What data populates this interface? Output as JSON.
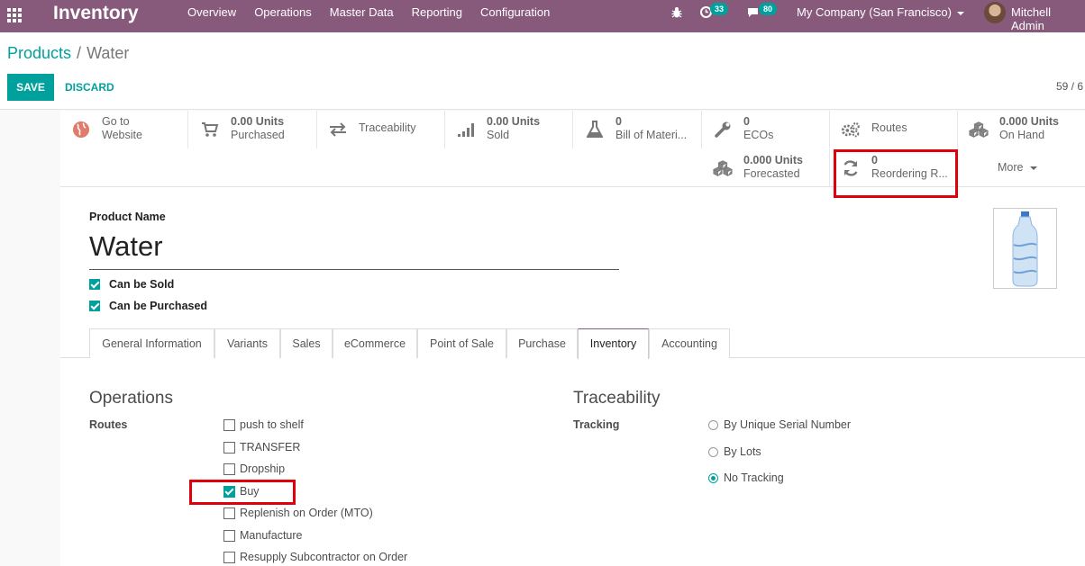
{
  "navbar": {
    "app_title": "Inventory",
    "menu": [
      "Overview",
      "Operations",
      "Master Data",
      "Reporting",
      "Configuration"
    ],
    "activity_count": "33",
    "messages_count": "80",
    "company": "My Company (San Francisco)",
    "user": "Mitchell Admin",
    "icons": [
      "apps-grid-icon",
      "bug-icon",
      "activity-clock-icon",
      "chat-icon"
    ]
  },
  "breadcrumb": {
    "parent": "Products",
    "separator": "/",
    "current": "Water"
  },
  "actions": {
    "save": "SAVE",
    "discard": "DISCARD"
  },
  "pager": {
    "text": "59 / 6"
  },
  "smart_buttons": [
    {
      "id": "website",
      "value": "Go to",
      "label": "Website",
      "icon": "globe-icon"
    },
    {
      "id": "purchased",
      "value": "0.00 Units",
      "label": "Purchased",
      "icon": "cart-icon"
    },
    {
      "id": "traceability",
      "value": "",
      "label": "Traceability",
      "icon": "arrows-exchange-icon"
    },
    {
      "id": "sold",
      "value": "0.00 Units",
      "label": "Sold",
      "icon": "signal-bars-icon"
    },
    {
      "id": "bom",
      "value": "0",
      "label": "Bill of Materi...",
      "icon": "flask-icon"
    },
    {
      "id": "ecos",
      "value": "0",
      "label": "ECOs",
      "icon": "wrench-icon"
    },
    {
      "id": "routes",
      "value": "",
      "label": "Routes",
      "icon": "gears-icon"
    },
    {
      "id": "onhand",
      "value": "0.000 Units",
      "label": "On Hand",
      "icon": "cubes-icon"
    },
    {
      "id": "forecasted",
      "value": "0.000 Units",
      "label": "Forecasted",
      "icon": "cubes-icon"
    },
    {
      "id": "reordering",
      "value": "0",
      "label": "Reordering R...",
      "icon": "refresh-icon"
    }
  ],
  "more_label": "More",
  "product": {
    "name_label": "Product Name",
    "name": "Water",
    "can_be_sold": "Can be Sold",
    "can_be_purchased": "Can be Purchased"
  },
  "tabs": [
    "General Information",
    "Variants",
    "Sales",
    "eCommerce",
    "Point of Sale",
    "Purchase",
    "Inventory",
    "Accounting"
  ],
  "active_tab": "Inventory",
  "operations": {
    "title": "Operations",
    "routes_label": "Routes",
    "routes": [
      {
        "label": "push to shelf",
        "checked": false
      },
      {
        "label": "TRANSFER",
        "checked": false
      },
      {
        "label": "Dropship",
        "checked": false
      },
      {
        "label": "Buy",
        "checked": true
      },
      {
        "label": "Replenish on Order (MTO)",
        "checked": false
      },
      {
        "label": "Manufacture",
        "checked": false
      },
      {
        "label": "Resupply Subcontractor on Order",
        "checked": false
      }
    ]
  },
  "traceability": {
    "title": "Traceability",
    "tracking_label": "Tracking",
    "options": [
      {
        "label": "By Unique Serial Number",
        "checked": false
      },
      {
        "label": "By Lots",
        "checked": false
      },
      {
        "label": "No Tracking",
        "checked": true
      }
    ]
  },
  "colors": {
    "brand": "#875a7b",
    "accent": "#00a09d",
    "highlight": "#e0000c"
  }
}
